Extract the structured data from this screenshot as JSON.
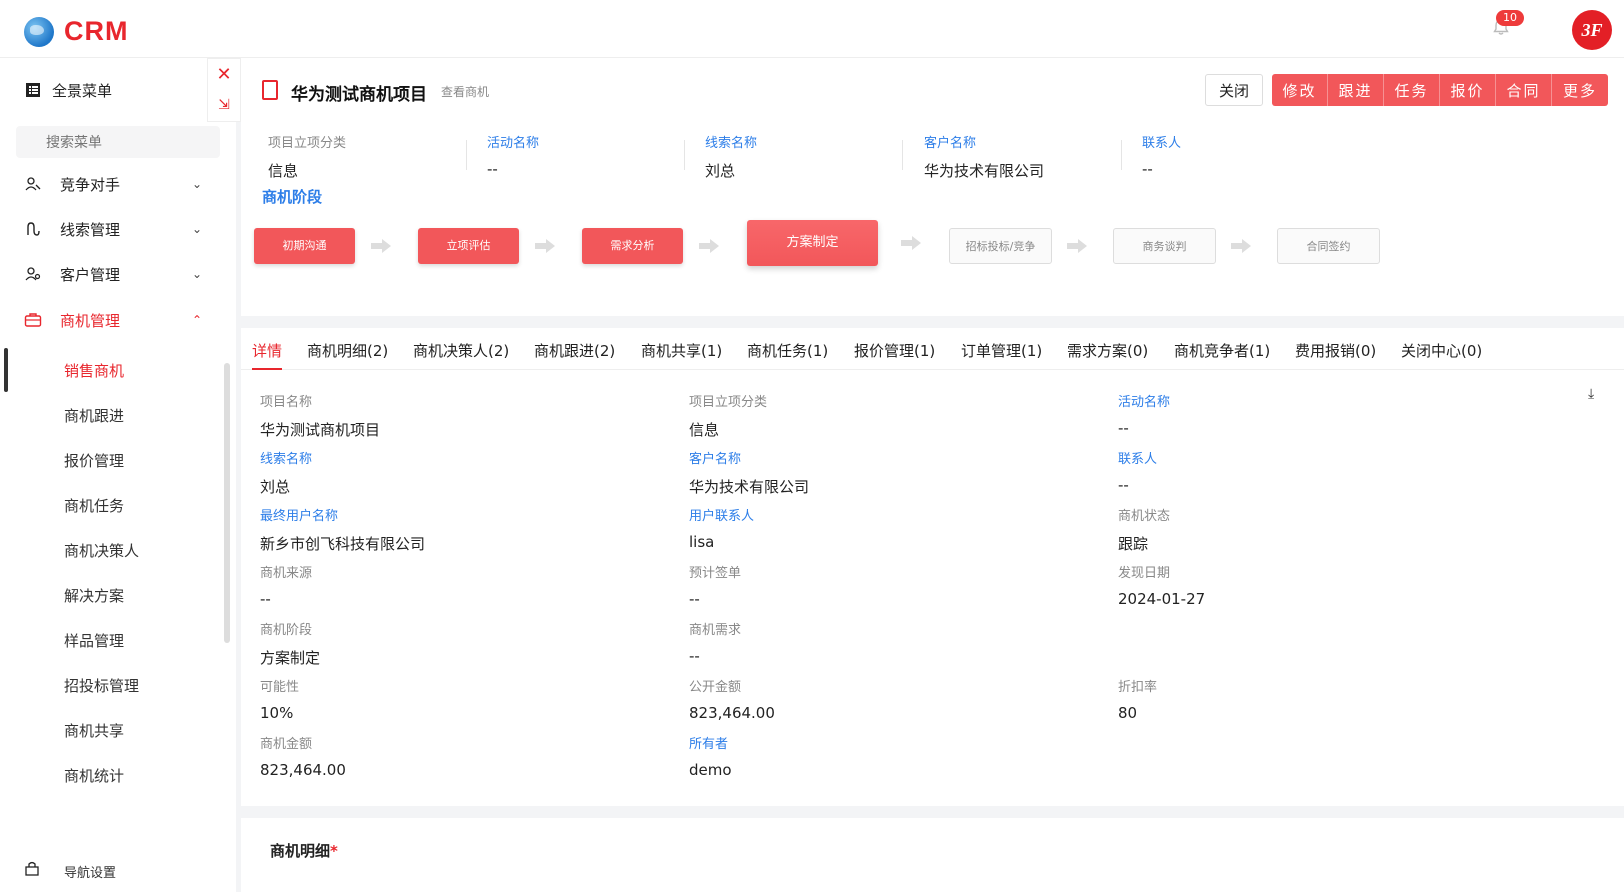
{
  "brand": {
    "logo_text": "CRM"
  },
  "notifications": {
    "count": "10"
  },
  "avatar": {
    "text": "3F"
  },
  "sidebar": {
    "panorama_menu": "全景菜单",
    "search_placeholder": "搜索菜单",
    "groups": [
      {
        "label": "竞争对手"
      },
      {
        "label": "线索管理"
      },
      {
        "label": "客户管理"
      },
      {
        "label": "商机管理"
      }
    ],
    "subitems": [
      {
        "label": "销售商机"
      },
      {
        "label": "商机跟进"
      },
      {
        "label": "报价管理"
      },
      {
        "label": "商机任务"
      },
      {
        "label": "商机决策人"
      },
      {
        "label": "解决方案"
      },
      {
        "label": "样品管理"
      },
      {
        "label": "招投标管理"
      },
      {
        "label": "商机共享"
      },
      {
        "label": "商机统计"
      }
    ],
    "nav_setting": "导航设置"
  },
  "header": {
    "title": "华为测试商机项目",
    "subtitle": "查看商机",
    "close_label": "关闭",
    "actions": [
      "修改",
      "跟进",
      "任务",
      "报价",
      "合同",
      "更多"
    ]
  },
  "summary": [
    {
      "key": "项目立项分类",
      "value": "信息",
      "link": false
    },
    {
      "key": "活动名称",
      "value": "--",
      "link": true
    },
    {
      "key": "线索名称",
      "value": "刘总",
      "link": true
    },
    {
      "key": "客户名称",
      "value": "华为技术有限公司",
      "link": true
    },
    {
      "key": "联系人",
      "value": "--",
      "link": true
    }
  ],
  "stage_section": {
    "title": "商机阶段",
    "stages": [
      {
        "label": "初期沟通",
        "state": "done"
      },
      {
        "label": "立项评估",
        "state": "done"
      },
      {
        "label": "需求分析",
        "state": "done"
      },
      {
        "label": "方案制定",
        "state": "current"
      },
      {
        "label": "招标投标/竞争",
        "state": "todo"
      },
      {
        "label": "商务谈判",
        "state": "todo"
      },
      {
        "label": "合同签约",
        "state": "todo"
      }
    ]
  },
  "tabs": [
    "详情",
    "商机明细(2)",
    "商机决策人(2)",
    "商机跟进(2)",
    "商机共享(1)",
    "商机任务(1)",
    "报价管理(1)",
    "订单管理(1)",
    "需求方案(0)",
    "商机竞争者(1)",
    "费用报销(0)",
    "关闭中心(0)"
  ],
  "detail_fields": [
    {
      "key": "项目名称",
      "value": "华为测试商机项目",
      "link": false
    },
    {
      "key": "项目立项分类",
      "value": "信息",
      "link": false
    },
    {
      "key": "活动名称",
      "value": "--",
      "link": true
    },
    {
      "key": "线索名称",
      "value": "刘总",
      "link": true
    },
    {
      "key": "客户名称",
      "value": "华为技术有限公司",
      "link": true
    },
    {
      "key": "联系人",
      "value": "--",
      "link": true
    },
    {
      "key": "最终用户名称",
      "value": "新乡市创飞科技有限公司",
      "link": true
    },
    {
      "key": "用户联系人",
      "value": "lisa",
      "link": true
    },
    {
      "key": "商机状态",
      "value": "跟踪",
      "link": false
    },
    {
      "key": "商机来源",
      "value": "--",
      "link": false
    },
    {
      "key": "预计签单",
      "value": "--",
      "link": false
    },
    {
      "key": "发现日期",
      "value": "2024-01-27",
      "link": false
    },
    {
      "key": "商机阶段",
      "value": "方案制定",
      "link": false
    },
    {
      "key": "商机需求",
      "value": "--",
      "link": false
    },
    {
      "key": "可能性",
      "value": "10%",
      "link": false
    },
    {
      "key": "公开金额",
      "value": "823,464.00",
      "link": false
    },
    {
      "key": "折扣率",
      "value": "80",
      "link": false
    },
    {
      "key": "商机金额",
      "value": "823,464.00",
      "link": false
    },
    {
      "key": "所有者",
      "value": "demo",
      "link": true
    }
  ],
  "bottom_section": {
    "title": "商机明细",
    "required_mark": "*"
  },
  "colors": {
    "accent": "#e8262d",
    "button": "#f2575a",
    "link": "#2d7ee8"
  }
}
